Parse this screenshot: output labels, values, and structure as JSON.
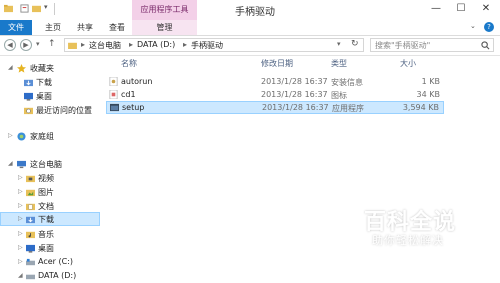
{
  "window": {
    "title": "手柄驱动",
    "context_tab_header": "应用程序工具",
    "buttons": [
      "—",
      "☐",
      "✕"
    ]
  },
  "ribbon": {
    "tabs": [
      {
        "label": "文件"
      },
      {
        "label": "主页"
      },
      {
        "label": "共享"
      },
      {
        "label": "查看"
      },
      {
        "label": "管理"
      }
    ],
    "help": "?"
  },
  "address": {
    "crumbs": [
      "这台电脑",
      "DATA (D:)",
      "手柄驱动"
    ],
    "separator": "▸",
    "search_placeholder": "搜索\"手柄驱动\""
  },
  "sidebar": {
    "items": [
      {
        "label": "收藏夹",
        "icon": "star-icon"
      },
      {
        "label": "下载",
        "icon": "download-folder-icon"
      },
      {
        "label": "桌面",
        "icon": "desktop-icon"
      },
      {
        "label": "最近访问的位置",
        "icon": "recent-places-icon"
      },
      {
        "label": "家庭组",
        "icon": "homegroup-icon"
      },
      {
        "label": "这台电脑",
        "icon": "computer-icon"
      },
      {
        "label": "视频",
        "icon": "video-folder-icon"
      },
      {
        "label": "图片",
        "icon": "pictures-folder-icon"
      },
      {
        "label": "文档",
        "icon": "documents-folder-icon"
      },
      {
        "label": "下载",
        "icon": "download-folder-icon"
      },
      {
        "label": "音乐",
        "icon": "music-folder-icon"
      },
      {
        "label": "桌面",
        "icon": "desktop-icon"
      },
      {
        "label": "Acer (C:)",
        "icon": "drive-icon"
      },
      {
        "label": "DATA (D:)",
        "icon": "drive-icon"
      }
    ]
  },
  "columns": [
    "名称",
    "修改日期",
    "类型",
    "大小"
  ],
  "files": [
    {
      "name": "autorun",
      "date": "2013/1/28 16:37",
      "type": "安装信息",
      "size": "1 KB",
      "icon": "setup-info-file-icon"
    },
    {
      "name": "cd1",
      "date": "2013/1/28 16:37",
      "type": "图标",
      "size": "34 KB",
      "icon": "icon-file-icon"
    },
    {
      "name": "setup",
      "date": "2013/1/28 16:37",
      "type": "应用程序",
      "size": "3,594 KB",
      "icon": "application-icon"
    }
  ],
  "watermark": {
    "title": "百科全说",
    "subtitle": "助你轻松解决"
  },
  "colors": {
    "file_tab": "#1979ca",
    "context_tab": "#f3d0e8",
    "selection": "#cce8ff"
  }
}
